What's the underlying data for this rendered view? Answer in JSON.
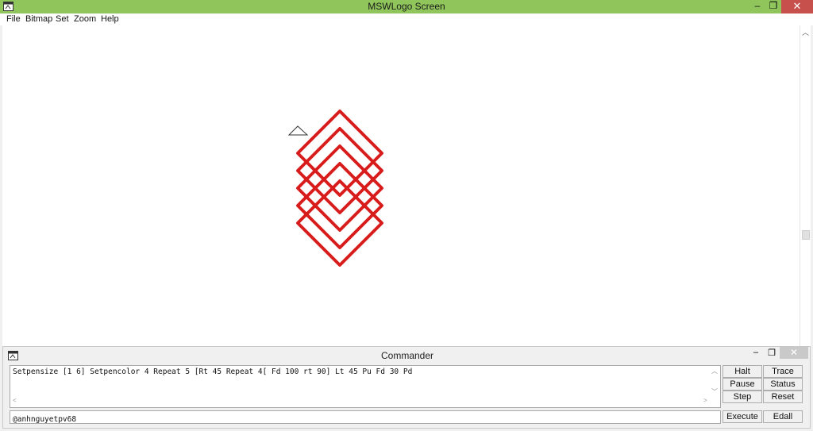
{
  "window": {
    "title": "MSWLogo Screen"
  },
  "menu": {
    "items": [
      "File",
      "Bitmap",
      "Set",
      "Zoom",
      "Help"
    ]
  },
  "controls": {
    "minimize": "–",
    "maximize": "❐",
    "close": "✕"
  },
  "turtle": {
    "pen_color": "#d81b1b",
    "pen_size": 6,
    "turtle_color": "#333333"
  },
  "commander": {
    "title": "Commander",
    "history": "Setpensize [1 6] Setpencolor 4 Repeat 5 [Rt 45 Repeat 4[ Fd 100 rt 90] Lt 45 Pu Fd 30 Pd",
    "input_value": "@anhnguyetpv68",
    "buttons": {
      "halt": "Halt",
      "trace": "Trace",
      "pause": "Pause",
      "status": "Status",
      "step": "Step",
      "reset": "Reset",
      "execute": "Execute",
      "edall": "Edall"
    }
  },
  "colors": {
    "title_bar": "#8fc55b",
    "close": "#c7504d"
  }
}
